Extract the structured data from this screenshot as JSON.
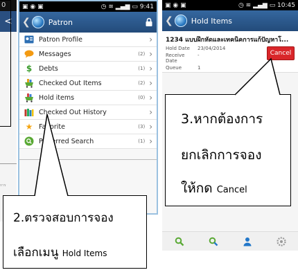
{
  "left_phone": {
    "status_text": "0",
    "action_glyph": "<",
    "tiny_text": "การ"
  },
  "middle_phone": {
    "status_left": "▣ ◉ ▣",
    "status_right": "◷ ≋ ▂▄▆ ▭ 9:41",
    "title": "Patron",
    "items": [
      {
        "label": "Patron Profile",
        "count": "",
        "icon": "person-card-icon"
      },
      {
        "label": "Messages",
        "count": "(2)",
        "icon": "speech-bubble-icon"
      },
      {
        "label": "Debts",
        "count": "(1)",
        "icon": "dollar-icon"
      },
      {
        "label": "Checked Out Items",
        "count": "(2)",
        "icon": "cart-icon"
      },
      {
        "label": "Hold items",
        "count": "(0)",
        "icon": "cart-hold-icon"
      },
      {
        "label": "Checked Out History",
        "count": "",
        "icon": "books-icon"
      },
      {
        "label": "Favorite",
        "count": "(3)",
        "icon": "star-icon"
      },
      {
        "label": "Preferred Search",
        "count": "(1)",
        "icon": "search-circle-icon"
      }
    ]
  },
  "right_phone": {
    "status_left": "▣ ◉ ▣",
    "status_right": "◷ ≋ ▂▄▆ ▭ 10:45",
    "title": "Hold Items",
    "hold": {
      "title": "1234 แบบฝึกหัดและเทคนิคการแก้ปัญหาโ...",
      "hold_date_label": "Hold Date",
      "hold_date_value": "23/04/2014",
      "receive_date_label": "Receive Date",
      "receive_date_value": "-",
      "queue_label": "Queue",
      "queue_value": "1",
      "cancel_label": "Cancel"
    }
  },
  "callout3": {
    "line1": "3.หากต้องการ",
    "line2": "ยกเลิกการจอง",
    "line3_th": "ให้กด ",
    "line3_en": "Cancel"
  },
  "callout2": {
    "line1": "2.ตรวจสอบการจอง",
    "line2_th": "เลือกเมนู ",
    "line2_en": "Hold Items"
  },
  "colors": {
    "actionbar": "#2a5a8f",
    "cancel": "#d9262a",
    "bottom_green": "#5aa935",
    "bottom_blue": "#2277c9"
  }
}
